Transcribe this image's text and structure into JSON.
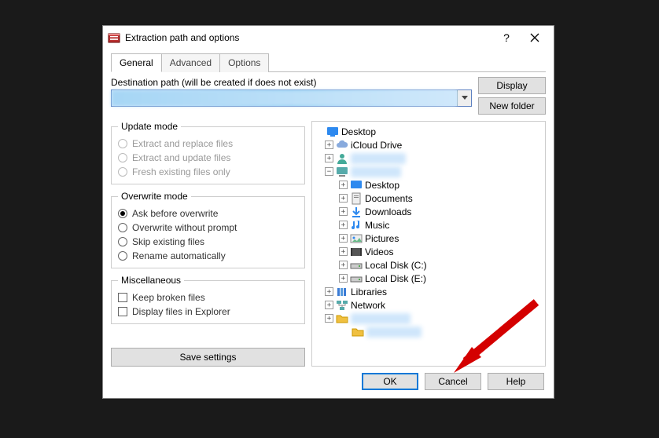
{
  "window": {
    "title": "Extraction path and options"
  },
  "tabs": {
    "general": "General",
    "advanced": "Advanced",
    "options": "Options"
  },
  "destination": {
    "label": "Destination path (will be created if does not exist)",
    "value": "(redacted)"
  },
  "sideButtons": {
    "display": "Display",
    "newFolder": "New folder"
  },
  "updateMode": {
    "legend": "Update mode",
    "extractReplace": "Extract and replace files",
    "extractUpdate": "Extract and update files",
    "freshOnly": "Fresh existing files only"
  },
  "overwriteMode": {
    "legend": "Overwrite mode",
    "ask": "Ask before overwrite",
    "without": "Overwrite without prompt",
    "skip": "Skip existing files",
    "rename": "Rename automatically"
  },
  "misc": {
    "legend": "Miscellaneous",
    "keepBroken": "Keep broken files",
    "displayExplorer": "Display files in Explorer"
  },
  "saveSettings": "Save settings",
  "tree": {
    "desktop": "Desktop",
    "icloud": "iCloud Drive",
    "subDesktop": "Desktop",
    "documents": "Documents",
    "downloads": "Downloads",
    "music": "Music",
    "pictures": "Pictures",
    "videos": "Videos",
    "localC": "Local Disk (C:)",
    "localE": "Local Disk (E:)",
    "libraries": "Libraries",
    "network": "Network"
  },
  "bottom": {
    "ok": "OK",
    "cancel": "Cancel",
    "help": "Help"
  }
}
